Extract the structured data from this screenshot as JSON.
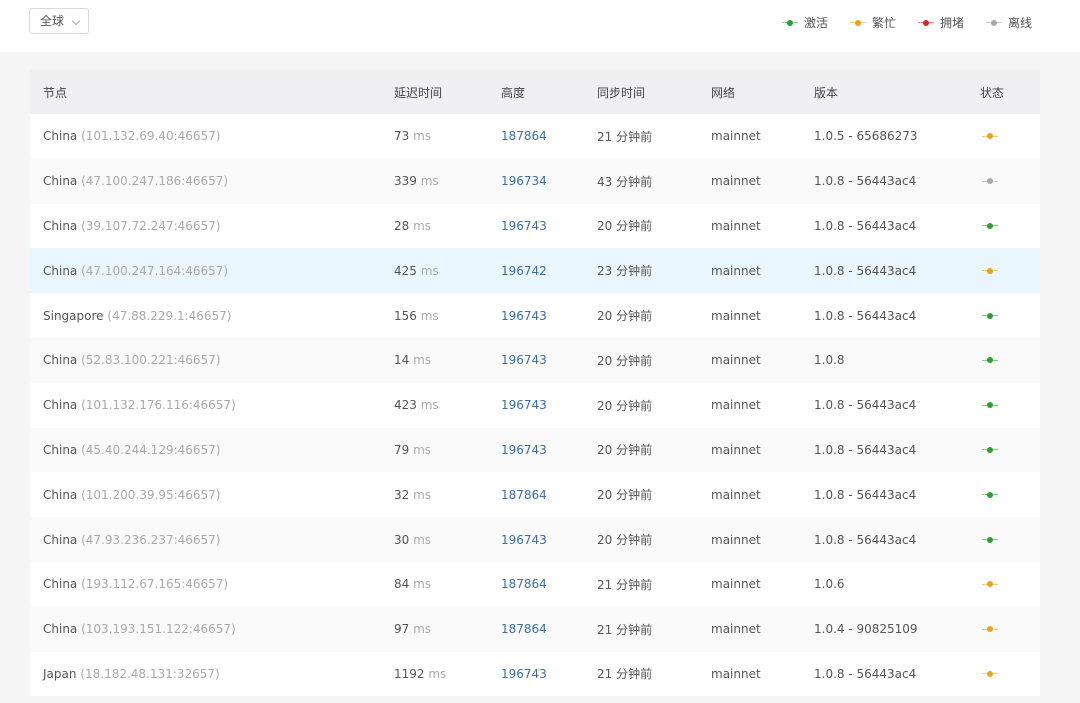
{
  "region_select": {
    "value": "全球"
  },
  "legend": [
    {
      "label": "激活",
      "color": "#2ca02c"
    },
    {
      "label": "繁忙",
      "color": "#f0a020"
    },
    {
      "label": "拥堵",
      "color": "#d62728"
    },
    {
      "label": "离线",
      "color": "#aaaaaa"
    }
  ],
  "columns": {
    "node": "节点",
    "latency": "延迟时间",
    "height": "高度",
    "sync": "同步时间",
    "network": "网络",
    "version": "版本",
    "status": "状态"
  },
  "unit_ms": "ms",
  "rows": [
    {
      "country": "China",
      "addr": "(101.132.69.40:46657)",
      "latency": "73",
      "height": "187864",
      "sync": "21 分钟前",
      "network": "mainnet",
      "version": "1.0.5 - 65686273",
      "status_color": "#f0a020"
    },
    {
      "country": "China",
      "addr": "(47.100.247.186:46657)",
      "latency": "339",
      "height": "196734",
      "sync": "43 分钟前",
      "network": "mainnet",
      "version": "1.0.8 - 56443ac4",
      "status_color": "#aaaaaa"
    },
    {
      "country": "China",
      "addr": "(39.107.72.247:46657)",
      "latency": "28",
      "height": "196743",
      "sync": "20 分钟前",
      "network": "mainnet",
      "version": "1.0.8 - 56443ac4",
      "status_color": "#2ca02c"
    },
    {
      "country": "China",
      "addr": "(47.100.247.164:46657)",
      "latency": "425",
      "height": "196742",
      "sync": "23 分钟前",
      "network": "mainnet",
      "version": "1.0.8 - 56443ac4",
      "status_color": "#f0a020",
      "highlight": true
    },
    {
      "country": "Singapore",
      "addr": "(47.88.229.1:46657)",
      "latency": "156",
      "height": "196743",
      "sync": "20 分钟前",
      "network": "mainnet",
      "version": "1.0.8 - 56443ac4",
      "status_color": "#2ca02c"
    },
    {
      "country": "China",
      "addr": "(52.83.100.221:46657)",
      "latency": "14",
      "height": "196743",
      "sync": "20 分钟前",
      "network": "mainnet",
      "version": "1.0.8",
      "status_color": "#2ca02c"
    },
    {
      "country": "China",
      "addr": "(101.132.176.116:46657)",
      "latency": "423",
      "height": "196743",
      "sync": "20 分钟前",
      "network": "mainnet",
      "version": "1.0.8 - 56443ac4",
      "status_color": "#2ca02c"
    },
    {
      "country": "China",
      "addr": "(45.40.244.129:46657)",
      "latency": "79",
      "height": "196743",
      "sync": "20 分钟前",
      "network": "mainnet",
      "version": "1.0.8 - 56443ac4",
      "status_color": "#2ca02c"
    },
    {
      "country": "China",
      "addr": "(101.200.39.95:46657)",
      "latency": "32",
      "height": "187864",
      "sync": "20 分钟前",
      "network": "mainnet",
      "version": "1.0.8 - 56443ac4",
      "status_color": "#2ca02c"
    },
    {
      "country": "China",
      "addr": "(47.93.236.237:46657)",
      "latency": "30",
      "height": "196743",
      "sync": "20 分钟前",
      "network": "mainnet",
      "version": "1.0.8 - 56443ac4",
      "status_color": "#2ca02c"
    },
    {
      "country": "China",
      "addr": "(193.112.67.165:46657)",
      "latency": "84",
      "height": "187864",
      "sync": "21 分钟前",
      "network": "mainnet",
      "version": "1.0.6",
      "status_color": "#f0a020"
    },
    {
      "country": "China",
      "addr": "(103.193.151.122:46657)",
      "latency": "97",
      "height": "187864",
      "sync": "21 分钟前",
      "network": "mainnet",
      "version": "1.0.4 - 90825109",
      "status_color": "#f0a020"
    },
    {
      "country": "Japan",
      "addr": "(18.182.48.131:32657)",
      "latency": "1192",
      "height": "196743",
      "sync": "21 分钟前",
      "network": "mainnet",
      "version": "1.0.8 - 56443ac4",
      "status_color": "#f0a020"
    }
  ]
}
